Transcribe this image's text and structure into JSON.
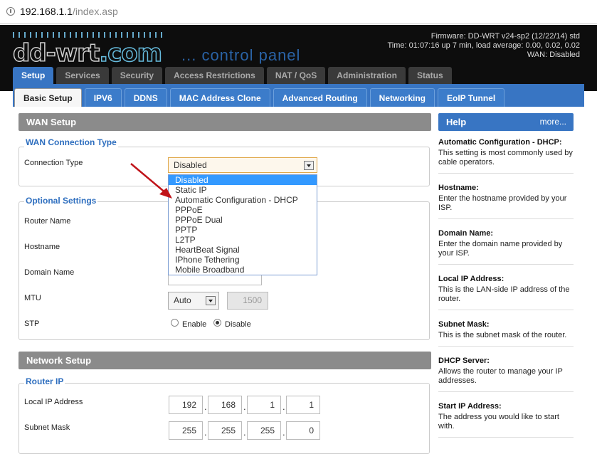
{
  "browser": {
    "host": "192.168.1.1",
    "path": "/index.asp"
  },
  "header": {
    "logo": "dd-wrt",
    "logo_suffix": ".com",
    "subtitle": "... control panel",
    "firmware": "Firmware: DD-WRT v24-sp2 (12/22/14) std",
    "time": "Time: 01:07:16 up 7 min, load average: 0.00, 0.02, 0.02",
    "wan": "WAN: Disabled"
  },
  "main_tabs": [
    "Setup",
    "Services",
    "Security",
    "Access Restrictions",
    "NAT / QoS",
    "Administration",
    "Status"
  ],
  "sub_tabs": [
    "Basic Setup",
    "IPV6",
    "DDNS",
    "MAC Address Clone",
    "Advanced Routing",
    "Networking",
    "EoIP Tunnel"
  ],
  "wan": {
    "title": "WAN Setup",
    "conn_legend": "WAN Connection Type",
    "conn_label": "Connection Type",
    "conn_value": "Disabled",
    "options": [
      "Disabled",
      "Static IP",
      "Automatic Configuration - DHCP",
      "PPPoE",
      "PPPoE Dual",
      "PPTP",
      "L2TP",
      "HeartBeat Signal",
      "IPhone Tethering",
      "Mobile Broadband"
    ],
    "opt_legend": "Optional Settings",
    "router_name": "Router Name",
    "hostname": "Hostname",
    "domain_name": "Domain Name",
    "mtu": "MTU",
    "mtu_mode": "Auto",
    "mtu_value": "1500",
    "stp": "STP",
    "enable": "Enable",
    "disable": "Disable"
  },
  "network": {
    "title": "Network Setup",
    "legend": "Router IP",
    "local_ip_label": "Local IP Address",
    "local_ip": [
      "192",
      "168",
      "1",
      "1"
    ],
    "subnet_label": "Subnet Mask",
    "subnet": [
      "255",
      "255",
      "255",
      "0"
    ]
  },
  "help": {
    "title": "Help",
    "more": "more...",
    "items": [
      {
        "t": "Automatic Configuration - DHCP:",
        "d": "This setting is most commonly used by cable operators."
      },
      {
        "t": "Hostname:",
        "d": "Enter the hostname provided by your ISP."
      },
      {
        "t": "Domain Name:",
        "d": "Enter the domain name provided by your ISP."
      },
      {
        "t": "Local IP Address:",
        "d": "This is the LAN-side IP address of the router."
      },
      {
        "t": "Subnet Mask:",
        "d": "This is the subnet mask of the router."
      },
      {
        "t": "DHCP Server:",
        "d": "Allows the router to manage your IP addresses."
      },
      {
        "t": "Start IP Address:",
        "d": "The address you would like to start with."
      }
    ]
  },
  "colors": {
    "accent": "#3875c3",
    "header_bg": "#0d0d0d",
    "section_bar": "#8b8b8b",
    "highlight": "#3399ff",
    "arrow": "#c0141a"
  }
}
